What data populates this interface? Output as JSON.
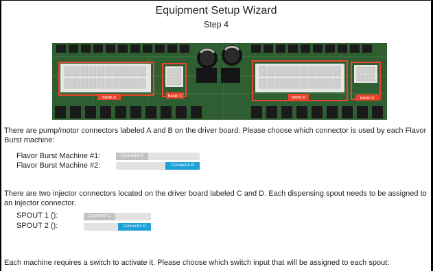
{
  "header": {
    "title": "Equipment Setup Wizard",
    "step": "Step 4"
  },
  "board_labels": {
    "bank_a": "BANK A",
    "bank_b": "BANK B",
    "bank_c": "BANK C",
    "bank_d": "BANK D"
  },
  "pump_section": {
    "text": "There are pump/motor connectors labeled A and B on the driver board. Please choose which connector is used by each Flavor Burst machine:",
    "machines": [
      {
        "label": "Flavor Burst Machine #1:",
        "selected": "Connector A"
      },
      {
        "label": "Flavor Burst Machine #2:",
        "selected": "Connector B"
      }
    ]
  },
  "injector_section": {
    "text": "There are two injector connectors located on the driver board labeled C and D. Each dispensing spout needs to be assigned to an injector connector.",
    "spouts": [
      {
        "label": "SPOUT 1 ():",
        "selected": "Connector C"
      },
      {
        "label": "SPOUT 2 ():",
        "selected": "Connector D"
      }
    ]
  },
  "switch_section": {
    "text": "Each machine requires a switch to activate it. Please choose which switch input that will be assigned to each spout:"
  },
  "colors": {
    "selected_blue": "#1ea1d6",
    "selected_gray": "#c2c2c2",
    "toggle_track": "#e2e2e2",
    "highlight_red": "#e8452c"
  }
}
